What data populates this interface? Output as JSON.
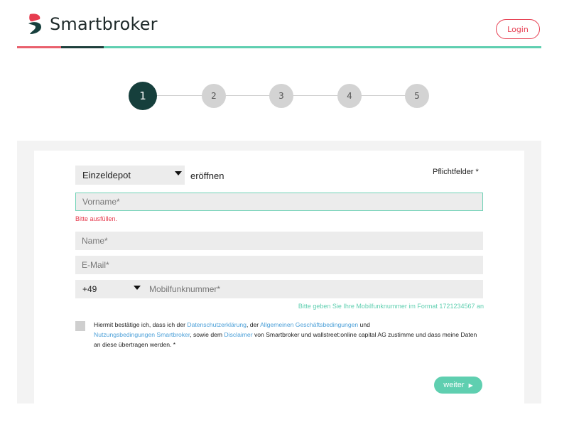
{
  "header": {
    "brand": "Smartbroker",
    "login_label": "Login",
    "colors": {
      "red": "#e9606d",
      "dark": "#1e3f3c",
      "green": "#5fcfb0"
    }
  },
  "stepper": {
    "steps": [
      "1",
      "2",
      "3",
      "4",
      "5"
    ],
    "active": 1
  },
  "form": {
    "depot_type": "Einzeldepot",
    "open_label": "eröffnen",
    "required_label": "Pflichtfelder *",
    "first_name_placeholder": "Vorname*",
    "first_name_error": "Bitte ausfüllen.",
    "last_name_placeholder": "Name*",
    "email_placeholder": "E-Mail*",
    "country_code": "+49",
    "phone_placeholder": "Mobilfunknummer*",
    "phone_hint": "Bitte geben Sie Ihre Mobilfunknummer im Format 1721234567 an",
    "consent": {
      "t1": "Hiermit bestätige ich, dass ich der ",
      "link1": "Datenschutzerklärung",
      "t2": ", der ",
      "link2": "Allgemeinen Geschäftsbedingungen",
      "t3": " und ",
      "link3": "Nutzungsbedingungen Smartbroker",
      "t4": ", sowie dem ",
      "link4": "Disclaimer",
      "t5": " von Smartbroker und wallstreet:online capital AG zustimme und dass meine Daten an diese übertragen werden. *"
    },
    "next_label": "weiter",
    "next_arrow": "▶"
  }
}
